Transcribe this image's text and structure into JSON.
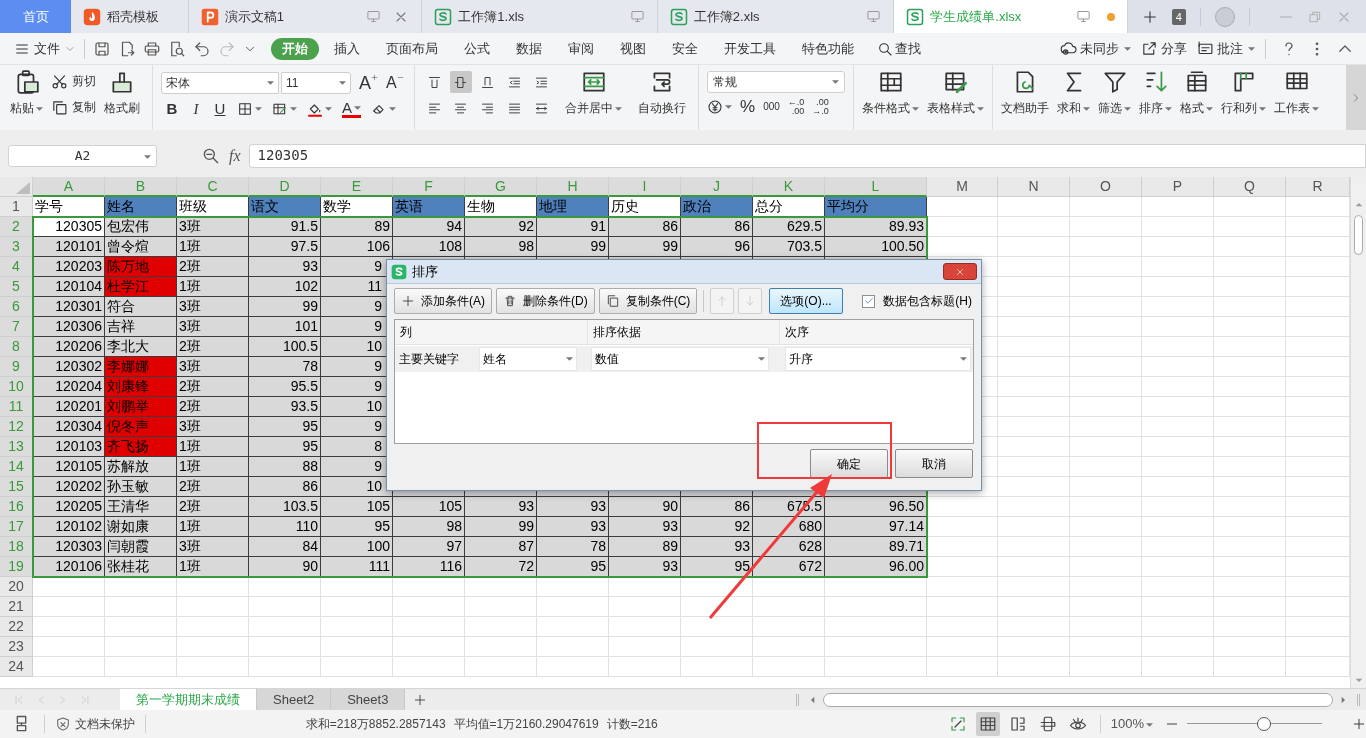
{
  "tabs": [
    {
      "label": "首页",
      "kind": "home",
      "selected": false,
      "closable": false,
      "unsaved": false
    },
    {
      "label": "稻壳模板",
      "kind": "template",
      "selected": false,
      "closable": false,
      "unsaved": false
    },
    {
      "label": "演示文稿1",
      "kind": "presentation",
      "selected": false,
      "closable": true,
      "unsaved": false
    },
    {
      "label": "工作簿1.xls",
      "kind": "spreadsheet",
      "selected": false,
      "closable": false,
      "unsaved": false
    },
    {
      "label": "工作簿2.xls",
      "kind": "spreadsheet",
      "selected": false,
      "closable": false,
      "unsaved": false
    },
    {
      "label": "学生成绩单.xlsx",
      "kind": "spreadsheet",
      "selected": true,
      "closable": false,
      "unsaved": true
    }
  ],
  "window_count": "4",
  "menu": {
    "file": "文件",
    "items": [
      {
        "label": "开始",
        "selected": true
      },
      {
        "label": "插入",
        "selected": false
      },
      {
        "label": "页面布局",
        "selected": false
      },
      {
        "label": "公式",
        "selected": false
      },
      {
        "label": "数据",
        "selected": false
      },
      {
        "label": "审阅",
        "selected": false
      },
      {
        "label": "视图",
        "selected": false
      },
      {
        "label": "安全",
        "selected": false
      },
      {
        "label": "开发工具",
        "selected": false
      },
      {
        "label": "特色功能",
        "selected": false
      }
    ],
    "search": "查找",
    "right": [
      {
        "label": "未同步",
        "kind": "sync",
        "dropdown": true
      },
      {
        "label": "分享",
        "kind": "share",
        "dropdown": false
      },
      {
        "label": "批注",
        "kind": "comment",
        "dropdown": true
      }
    ]
  },
  "ribbon": {
    "paste": "粘贴",
    "cut": "剪切",
    "copy": "复制",
    "format_painter": "格式刷",
    "font": "宋体",
    "size": "11",
    "grow": "A",
    "shrink": "A",
    "styles": [
      "B",
      "I",
      "U"
    ],
    "font_color": "A",
    "align": [
      {
        "kind": "top",
        "selected": false
      },
      {
        "kind": "middle",
        "selected": true
      },
      {
        "kind": "bottom",
        "selected": false
      },
      {
        "kind": "outdent",
        "selected": false
      },
      {
        "kind": "indent",
        "selected": false
      },
      {
        "kind": "left",
        "selected": false
      },
      {
        "kind": "center",
        "selected": false
      },
      {
        "kind": "right",
        "selected": false
      },
      {
        "kind": "justify",
        "selected": false
      },
      {
        "kind": "distribute",
        "selected": false
      }
    ],
    "merge": "合并居中",
    "wrap": "自动换行",
    "number_format": "常规",
    "percent": "%",
    "thousands": "000",
    "decimals": [
      {
        "top": "←.0",
        "bottom": ".00"
      },
      {
        "top": ".00",
        "bottom": "→.0"
      }
    ],
    "conditional_format": "条件格式",
    "table_style": "表格样式",
    "tools": [
      {
        "label": "文档助手",
        "kind": "assistant",
        "dropdown": false
      },
      {
        "label": "求和",
        "kind": "sum",
        "dropdown": true
      },
      {
        "label": "筛选",
        "kind": "filter",
        "dropdown": true
      },
      {
        "label": "排序",
        "kind": "sort",
        "dropdown": true
      },
      {
        "label": "格式",
        "kind": "format",
        "dropdown": true
      },
      {
        "label": "行和列",
        "kind": "rowcol",
        "dropdown": true
      },
      {
        "label": "工作表",
        "kind": "sheet",
        "dropdown": true
      }
    ]
  },
  "formula_bar": {
    "cell": "A2",
    "fx": "fx",
    "value": "120305"
  },
  "sheet": {
    "columns": [
      {
        "label": "A",
        "selected": true
      },
      {
        "label": "B",
        "selected": true
      },
      {
        "label": "C",
        "selected": true
      },
      {
        "label": "D",
        "selected": true
      },
      {
        "label": "E",
        "selected": true
      },
      {
        "label": "F",
        "selected": true
      },
      {
        "label": "G",
        "selected": true
      },
      {
        "label": "H",
        "selected": true
      },
      {
        "label": "I",
        "selected": true
      },
      {
        "label": "J",
        "selected": true
      },
      {
        "label": "K",
        "selected": true
      },
      {
        "label": "L",
        "selected": true
      },
      {
        "label": "M",
        "selected": false
      },
      {
        "label": "N",
        "selected": false
      },
      {
        "label": "O",
        "selected": false
      },
      {
        "label": "P",
        "selected": false
      },
      {
        "label": "Q",
        "selected": false
      },
      {
        "label": "R",
        "selected": false
      }
    ],
    "rows": [
      {
        "number": "1",
        "kind": "header",
        "selected": false,
        "cells": [
          {
            "text": "学号",
            "highlight": false
          },
          {
            "text": "姓名",
            "highlight": true
          },
          {
            "text": "班级",
            "highlight": false
          },
          {
            "text": "语文",
            "highlight": true
          },
          {
            "text": "数学",
            "highlight": false
          },
          {
            "text": "英语",
            "highlight": true
          },
          {
            "text": "生物",
            "highlight": false
          },
          {
            "text": "地理",
            "highlight": true
          },
          {
            "text": "历史",
            "highlight": false
          },
          {
            "text": "政治",
            "highlight": true
          },
          {
            "text": "总分",
            "highlight": false
          },
          {
            "text": "平均分",
            "highlight": true
          }
        ]
      },
      {
        "number": "2",
        "kind": "data",
        "selected": true,
        "active": true,
        "flagged": false,
        "cells": [
          "120305",
          "包宏伟",
          "3班",
          "91.5",
          "89",
          "94",
          "92",
          "91",
          "86",
          "86",
          "629.5",
          "89.93"
        ]
      },
      {
        "number": "3",
        "kind": "data",
        "selected": true,
        "active": false,
        "flagged": false,
        "cells": [
          "120101",
          "曾令煊",
          "1班",
          "97.5",
          "106",
          "108",
          "98",
          "99",
          "99",
          "96",
          "703.5",
          "100.50"
        ]
      },
      {
        "number": "4",
        "kind": "data",
        "selected": true,
        "active": false,
        "flagged": true,
        "cells": [
          "120203",
          "陈万地",
          "2班",
          "93",
          "9"
        ]
      },
      {
        "number": "5",
        "kind": "data",
        "selected": true,
        "active": false,
        "flagged": true,
        "cells": [
          "120104",
          "杜学江",
          "1班",
          "102",
          "11"
        ]
      },
      {
        "number": "6",
        "kind": "data",
        "selected": true,
        "active": false,
        "flagged": false,
        "cells": [
          "120301",
          "符合",
          "3班",
          "99",
          "9"
        ]
      },
      {
        "number": "7",
        "kind": "data",
        "selected": true,
        "active": false,
        "flagged": false,
        "cells": [
          "120306",
          "吉祥",
          "3班",
          "101",
          "9"
        ]
      },
      {
        "number": "8",
        "kind": "data",
        "selected": true,
        "active": false,
        "flagged": false,
        "cells": [
          "120206",
          "李北大",
          "2班",
          "100.5",
          "10"
        ]
      },
      {
        "number": "9",
        "kind": "data",
        "selected": true,
        "active": false,
        "flagged": true,
        "cells": [
          "120302",
          "李娜娜",
          "3班",
          "78",
          "9"
        ]
      },
      {
        "number": "10",
        "kind": "data",
        "selected": true,
        "active": false,
        "flagged": true,
        "cells": [
          "120204",
          "刘康锋",
          "2班",
          "95.5",
          "9"
        ]
      },
      {
        "number": "11",
        "kind": "data",
        "selected": true,
        "active": false,
        "flagged": true,
        "cells": [
          "120201",
          "刘鹏举",
          "2班",
          "93.5",
          "10"
        ]
      },
      {
        "number": "12",
        "kind": "data",
        "selected": true,
        "active": false,
        "flagged": true,
        "cells": [
          "120304",
          "倪冬声",
          "3班",
          "95",
          "9"
        ]
      },
      {
        "number": "13",
        "kind": "data",
        "selected": true,
        "active": false,
        "flagged": true,
        "cells": [
          "120103",
          "齐飞扬",
          "1班",
          "95",
          "8"
        ]
      },
      {
        "number": "14",
        "kind": "data",
        "selected": true,
        "active": false,
        "flagged": false,
        "cells": [
          "120105",
          "苏解放",
          "1班",
          "88",
          "9"
        ]
      },
      {
        "number": "15",
        "kind": "data",
        "selected": true,
        "active": false,
        "flagged": false,
        "cells": [
          "120202",
          "孙玉敏",
          "2班",
          "86",
          "10"
        ]
      },
      {
        "number": "16",
        "kind": "data",
        "selected": true,
        "active": false,
        "flagged": false,
        "cells": [
          "120205",
          "王清华",
          "2班",
          "103.5",
          "105",
          "105",
          "93",
          "93",
          "90",
          "86",
          "675.5",
          "96.50"
        ]
      },
      {
        "number": "17",
        "kind": "data",
        "selected": true,
        "active": false,
        "flagged": false,
        "cells": [
          "120102",
          "谢如康",
          "1班",
          "110",
          "95",
          "98",
          "99",
          "93",
          "93",
          "92",
          "680",
          "97.14"
        ]
      },
      {
        "number": "18",
        "kind": "data",
        "selected": true,
        "active": false,
        "flagged": false,
        "cells": [
          "120303",
          "闫朝霞",
          "3班",
          "84",
          "100",
          "97",
          "87",
          "78",
          "89",
          "93",
          "628",
          "89.71"
        ]
      },
      {
        "number": "19",
        "kind": "data",
        "selected": true,
        "active": false,
        "flagged": false,
        "cells": [
          "120106",
          "张桂花",
          "1班",
          "90",
          "111",
          "116",
          "72",
          "95",
          "93",
          "95",
          "672",
          "96.00"
        ]
      },
      {
        "number": "20",
        "kind": "empty",
        "selected": false
      },
      {
        "number": "21",
        "kind": "empty",
        "selected": false
      },
      {
        "number": "22",
        "kind": "empty",
        "selected": false
      },
      {
        "number": "23",
        "kind": "empty",
        "selected": false
      },
      {
        "number": "24",
        "kind": "empty",
        "selected": false
      }
    ]
  },
  "sort_dialog": {
    "title": "排序",
    "toolbar": [
      {
        "label": "添加条件(A)",
        "kind": "add"
      },
      {
        "label": "删除条件(D)",
        "kind": "delete"
      },
      {
        "label": "复制条件(C)",
        "kind": "copy"
      }
    ],
    "arrows": [
      {
        "kind": "up",
        "disabled": true
      },
      {
        "kind": "down",
        "disabled": true
      }
    ],
    "options": "选项(O)...",
    "header_checkbox": {
      "label": "数据包含标题(H)",
      "checked": true
    },
    "columns": [
      "列",
      "排序依据",
      "次序"
    ],
    "rules": [
      {
        "label": "主要关键字",
        "column": "姓名",
        "sort_on": "数值",
        "order": "升序"
      }
    ],
    "ok": "确定",
    "cancel": "取消"
  },
  "sheet_tabs": [
    {
      "label": "第一学期期末成绩",
      "selected": true
    },
    {
      "label": "Sheet2",
      "selected": false
    },
    {
      "label": "Sheet3",
      "selected": false
    }
  ],
  "status": {
    "protection": "文档未保护",
    "sum": "求和=218万8852.2857143",
    "average": "平均值=1万2160.29047619",
    "count": "计数=216",
    "views": [
      {
        "kind": "fullscreen",
        "selected": false
      },
      {
        "kind": "normal",
        "selected": true
      },
      {
        "kind": "page_break",
        "selected": false
      },
      {
        "kind": "reading",
        "selected": false
      },
      {
        "kind": "eye",
        "selected": false
      }
    ],
    "zoom": "100%",
    "level": 0.57
  }
}
